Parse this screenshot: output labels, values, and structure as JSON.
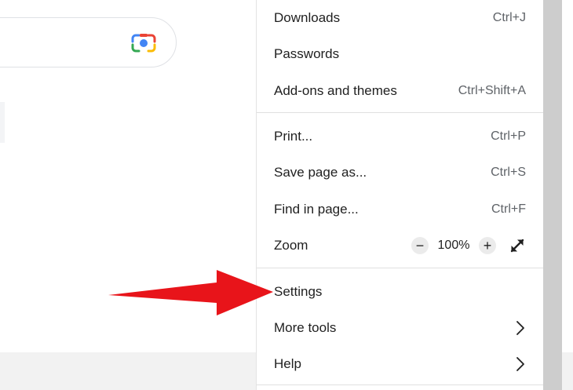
{
  "menu": {
    "downloads": {
      "label": "Downloads",
      "shortcut": "Ctrl+J"
    },
    "passwords": {
      "label": "Passwords"
    },
    "addons": {
      "label": "Add-ons and themes",
      "shortcut": "Ctrl+Shift+A"
    },
    "print": {
      "label": "Print...",
      "shortcut": "Ctrl+P"
    },
    "save_page": {
      "label": "Save page as...",
      "shortcut": "Ctrl+S"
    },
    "find": {
      "label": "Find in page...",
      "shortcut": "Ctrl+F"
    },
    "zoom": {
      "label": "Zoom",
      "minus": "−",
      "value": "100%",
      "plus": "+"
    },
    "settings": {
      "label": "Settings"
    },
    "more_tools": {
      "label": "More tools"
    },
    "help": {
      "label": "Help"
    }
  },
  "colors": {
    "arrow": "#e8141a",
    "lens_blue": "#4285f4",
    "lens_red": "#ea4335",
    "lens_yellow": "#fbbc05",
    "lens_green": "#34a853"
  },
  "icons": {
    "lens": "google-lens-icon",
    "fullscreen": "fullscreen-icon",
    "chevron": "chevron-right-icon",
    "arrow": "red-arrow-annotation"
  }
}
